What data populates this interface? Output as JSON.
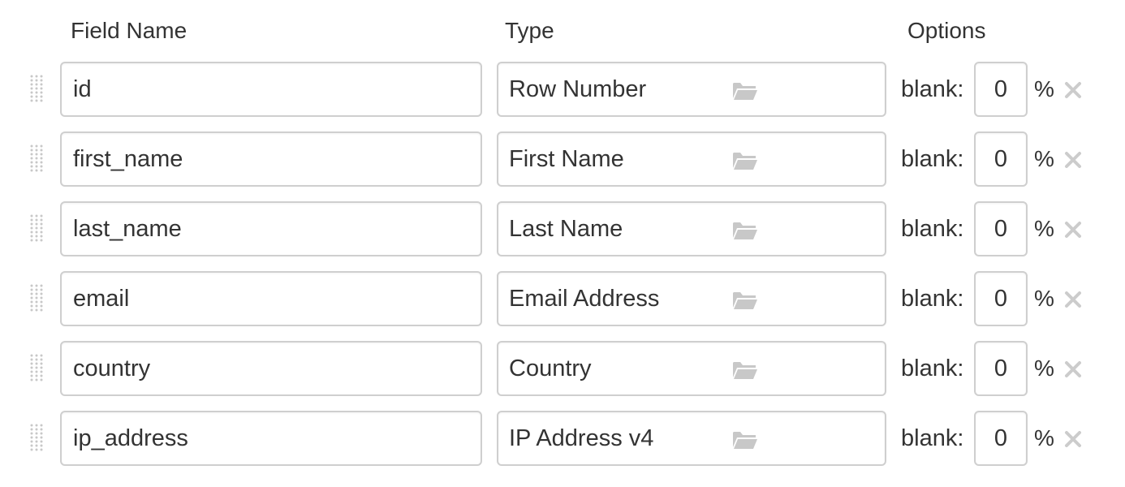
{
  "headers": {
    "field_name": "Field Name",
    "type": "Type",
    "options": "Options"
  },
  "rows": [
    {
      "field_name": "id",
      "type": "Row Number",
      "blank_label": "blank:",
      "blank_value": "0",
      "percent": "%"
    },
    {
      "field_name": "first_name",
      "type": "First Name",
      "blank_label": "blank:",
      "blank_value": "0",
      "percent": "%"
    },
    {
      "field_name": "last_name",
      "type": "Last Name",
      "blank_label": "blank:",
      "blank_value": "0",
      "percent": "%"
    },
    {
      "field_name": "email",
      "type": "Email Address",
      "blank_label": "blank:",
      "blank_value": "0",
      "percent": "%"
    },
    {
      "field_name": "country",
      "type": "Country",
      "blank_label": "blank:",
      "blank_value": "0",
      "percent": "%"
    },
    {
      "field_name": "ip_address",
      "type": "IP Address v4",
      "blank_label": "blank:",
      "blank_value": "0",
      "percent": "%"
    }
  ],
  "icons": {
    "drag_handle": "drag-handle-icon",
    "type_picker": "folder-open-icon",
    "remove": "close-icon"
  },
  "colors": {
    "text": "#333333",
    "border": "#cfcfcf",
    "icon": "#c8c8c8",
    "remove_icon": "#cccccc"
  }
}
